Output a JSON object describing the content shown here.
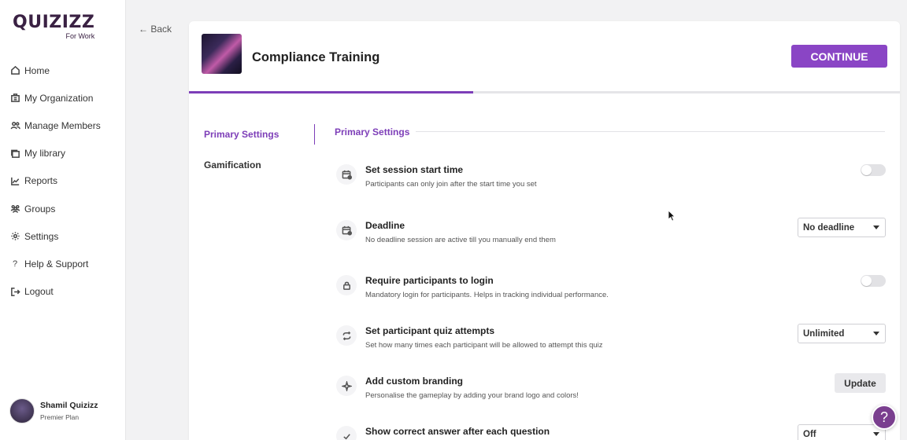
{
  "brand": {
    "logo_text": "QUIZIZZ",
    "logo_sub": "For Work"
  },
  "sidebar": {
    "items": [
      {
        "label": "Home",
        "icon": "home-icon"
      },
      {
        "label": "My Organization",
        "icon": "organization-icon"
      },
      {
        "label": "Manage Members",
        "icon": "members-icon"
      },
      {
        "label": "My library",
        "icon": "library-icon"
      },
      {
        "label": "Reports",
        "icon": "reports-icon"
      },
      {
        "label": "Groups",
        "icon": "groups-icon"
      },
      {
        "label": "Settings",
        "icon": "gear-icon"
      },
      {
        "label": "Help & Support",
        "icon": "question-icon"
      },
      {
        "label": "Logout",
        "icon": "logout-icon"
      }
    ],
    "user": {
      "name": "Shamil Quizizz",
      "plan": "Premier Plan"
    }
  },
  "back_label": "← Back",
  "header": {
    "title": "Compliance Training",
    "continue_label": "CONTINUE",
    "progress": 0.4
  },
  "tabs": [
    {
      "label": "Primary Settings",
      "active": true
    },
    {
      "label": "Gamification",
      "active": false
    }
  ],
  "section_title": "Primary Settings",
  "settings": [
    {
      "title": "Set session start time",
      "desc": "Participants can only join after the start time you set",
      "control": "toggle",
      "icon": "calendar-clock-icon"
    },
    {
      "title": "Deadline",
      "desc": "No deadline session are active till you manually end them",
      "control": "select",
      "value": "No deadline",
      "icon": "calendar-clock-icon"
    },
    {
      "title": "Require participants to login",
      "desc": "Mandatory login for participants. Helps in tracking individual performance.",
      "control": "toggle",
      "icon": "lock-icon"
    },
    {
      "title": "Set participant quiz attempts",
      "desc": "Set how many times each participant will be allowed to attempt this quiz",
      "control": "select",
      "value": "Unlimited",
      "icon": "repeat-icon"
    },
    {
      "title": "Add custom branding",
      "desc": "Personalise the gameplay by adding your brand logo and colors!",
      "control": "button",
      "value": "Update",
      "icon": "sparkle-icon"
    },
    {
      "title": "Show correct answer after each question",
      "desc": "",
      "control": "select",
      "value": "Off",
      "icon": "check-icon"
    }
  ],
  "help_label": "?",
  "colors": {
    "accent": "#8a45c5",
    "accent_dark": "#7d3eb8",
    "help": "#7a3f8f"
  }
}
